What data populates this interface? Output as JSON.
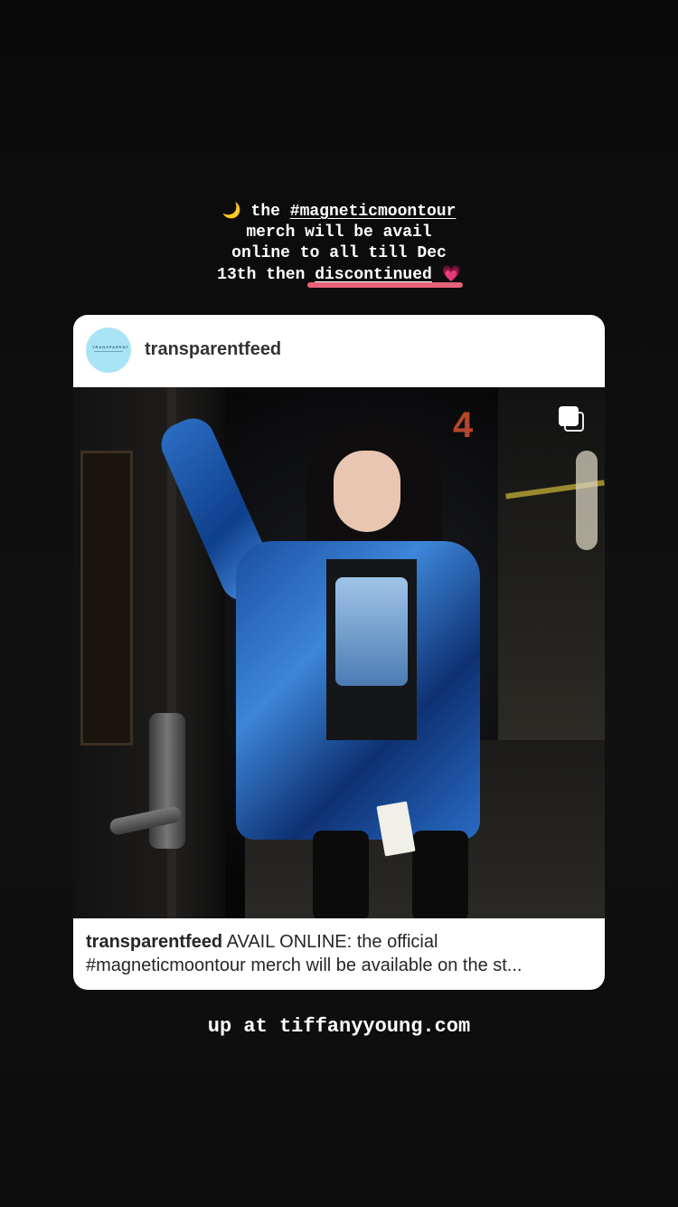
{
  "story": {
    "top_caption": {
      "line1_emoji": "🌙",
      "line1_text": " the ",
      "line1_hashtag": "#magneticmoontour",
      "line2": "merch will be avail",
      "line3": "online to all till Dec",
      "line4_text": "13th then ",
      "line4_underlined": "discontinued",
      "line4_emoji": "💗"
    },
    "post_card": {
      "username": "transparentfeed",
      "avatar_logo_text": "TRANSPARENT",
      "caption_user": "transparentfeed",
      "caption_line1": " AVAIL ONLINE: the official",
      "caption_line2": "#magneticmoontour merch will be available on the st..."
    },
    "bottom_caption": "up at tiffanyyoung.com"
  },
  "colors": {
    "background": "#0b0b0b",
    "card": "#ffffff",
    "underline_accent": "#e4627a",
    "avatar": "#a9e3f6"
  },
  "icons": {
    "multi_photo": "multi-photo-icon",
    "moon": "crescent-moon-emoji",
    "heart": "pink-heart-emoji"
  }
}
